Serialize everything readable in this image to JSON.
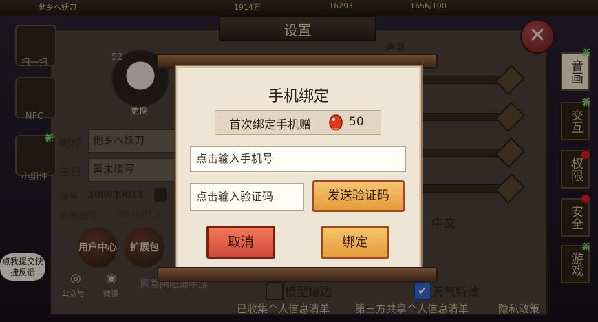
{
  "topbar": {
    "left_text": "他乡へ妖刀",
    "mid_text1": "1914万",
    "mid_text2": "16293",
    "mid_text3": "1656/100"
  },
  "settings": {
    "title": "设置",
    "voice_section": "声音",
    "language_value": "中文",
    "model_edge_label": "模型描边",
    "weather_label": "天气特效",
    "weather_checked": true,
    "model_edge_checked": false,
    "footer": {
      "collected": "已收集个人信息清单",
      "third_party": "第三方共享个人信息清单",
      "privacy": "隐私政策"
    }
  },
  "left_menu": [
    {
      "label": "扫一扫",
      "icon": "qr-scan-icon"
    },
    {
      "label": "NFC",
      "icon": "nfc-icon"
    },
    {
      "label": "小组件",
      "icon": "widget-icon",
      "badge": "新"
    }
  ],
  "profile": {
    "level": "52",
    "change_label": "更换",
    "nickname_label": "昵称",
    "nickname_value": "他乡へ妖刀",
    "birthday_label": "生日",
    "birthday_value": "暂未填写",
    "id_label": "编号",
    "id_value": "108939013",
    "old_id_label": "曾用编号",
    "old_id_value": "8939013",
    "user_center": "用户中心",
    "expand_pack": "扩展包",
    "feedback": "点我提交快捷反馈",
    "official_account": "公众号",
    "weibo": "微博",
    "game_name": "网易阴阳师手游"
  },
  "right_tabs": [
    {
      "label": "音画",
      "active": true,
      "badge": "新"
    },
    {
      "label": "交互",
      "active": false,
      "badge": "新"
    },
    {
      "label": "权限",
      "active": false,
      "dot": true
    },
    {
      "label": "安全",
      "active": false,
      "dot": true
    },
    {
      "label": "游戏",
      "active": false,
      "badge": "新"
    }
  ],
  "dialog": {
    "title": "手机绑定",
    "reward_text": "首次绑定手机赠",
    "reward_icon": "koi-fish-icon",
    "reward_count": "50",
    "phone_placeholder": "点击输入手机号",
    "code_placeholder": "点击输入验证码",
    "send_code": "发送验证码",
    "cancel": "取消",
    "bind": "绑定"
  },
  "colors": {
    "cancel": "#d24a3a",
    "primary": "#e59c3b",
    "dialog_bg": "#efe5d5"
  }
}
